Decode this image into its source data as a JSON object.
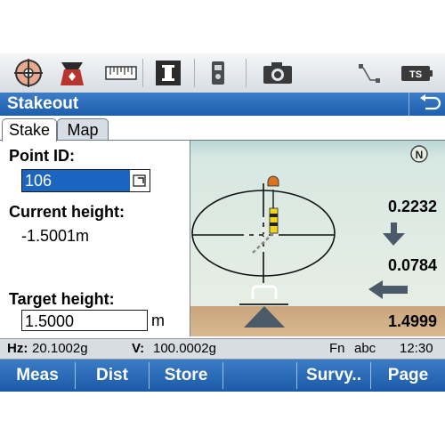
{
  "title": "Stakeout",
  "tabs": [
    {
      "label": "Stake",
      "active": true
    },
    {
      "label": "Map",
      "active": false
    }
  ],
  "toolbar": {
    "icons": [
      "target-icon",
      "observer-icon",
      "measure-ruler-icon",
      "info-icon",
      "instrument-icon",
      "camera-icon",
      "connection-icon",
      "battery-icon"
    ],
    "battery_label": "TS"
  },
  "fields": {
    "point_id_label": "Point ID:",
    "point_id_value": "106",
    "current_height_label": "Current height:",
    "current_height_value": "-1.5001m",
    "target_height_label": "Target height:",
    "target_height_value": "1.5000",
    "target_height_unit": "m"
  },
  "graphic": {
    "values": [
      "0.2232",
      "0.0784",
      "1.4999"
    ],
    "compass_label": "N"
  },
  "status": {
    "hz_label": "Hz:",
    "hz_value": "20.1002g",
    "v_label": "V:",
    "v_value": "100.0002g",
    "mode": "Fn",
    "input": "abc",
    "time": "12:30"
  },
  "softkeys": [
    "Meas",
    "Dist",
    "Store",
    "Survy..",
    "Page"
  ],
  "colors": {
    "accent_blue": "#1c5fae",
    "selection_blue": "#1b64c0"
  }
}
